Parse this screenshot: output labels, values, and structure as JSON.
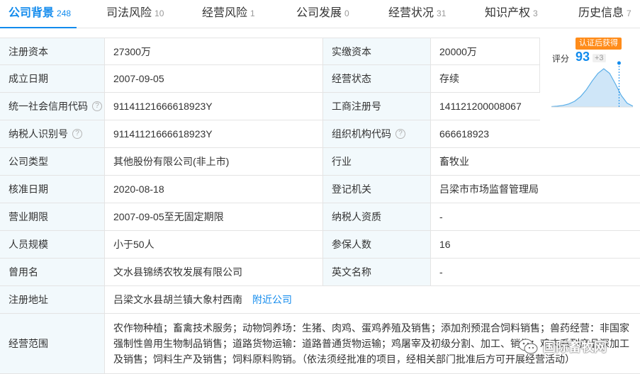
{
  "tabs": [
    {
      "label": "公司背景",
      "count": "248",
      "active": true
    },
    {
      "label": "司法风险",
      "count": "10"
    },
    {
      "label": "经营风险",
      "count": "1"
    },
    {
      "label": "公司发展",
      "count": "0"
    },
    {
      "label": "经营状况",
      "count": "31"
    },
    {
      "label": "知识产权",
      "count": "3"
    },
    {
      "label": "历史信息",
      "count": "7"
    }
  ],
  "info": {
    "reg_capital_label": "注册资本",
    "reg_capital": "27300万",
    "paid_capital_label": "实缴资本",
    "paid_capital": "20000万",
    "est_date_label": "成立日期",
    "est_date": "2007-09-05",
    "status_label": "经营状态",
    "status": "存续",
    "credit_code_label": "统一社会信用代码",
    "credit_code": "91141121666618923Y",
    "reg_no_label": "工商注册号",
    "reg_no": "141121200008067",
    "taxpayer_id_label": "纳税人识别号",
    "taxpayer_id": "91141121666618923Y",
    "org_code_label": "组织机构代码",
    "org_code": "666618923",
    "company_type_label": "公司类型",
    "company_type": "其他股份有限公司(非上市)",
    "industry_label": "行业",
    "industry": "畜牧业",
    "approval_date_label": "核准日期",
    "approval_date": "2020-08-18",
    "reg_authority_label": "登记机关",
    "reg_authority": "吕梁市市场监督管理局",
    "term_label": "营业期限",
    "term": "2007-09-05至无固定期限",
    "taxpayer_qual_label": "纳税人资质",
    "taxpayer_qual": "-",
    "staff_size_label": "人员规模",
    "staff_size": "小于50人",
    "insured_label": "参保人数",
    "insured": "16",
    "former_name_label": "曾用名",
    "former_name": "文水县锦绣农牧发展有限公司",
    "english_name_label": "英文名称",
    "english_name": "-",
    "address_label": "注册地址",
    "address": "吕梁文水县胡兰镇大象村西南",
    "nearby_link": "附近公司",
    "scope_label": "经营范围",
    "scope": "农作物种植；畜禽技术服务；动物饲养场：生猪、肉鸡、蛋鸡养殖及销售；添加剂预混合饲料销售；兽药经营：非国家强制性兽用生物制品销售；道路货物运输：道路普通货物运输；鸡屠宰及初级分割、加工、销售；鸡肉系列产品深加工及销售；饲料生产及销售；饲料原料购销。（依法须经批准的项目，经相关部门批准后方可开展经营活动）"
  },
  "help_icon": "?",
  "score": {
    "badge": "认证后获得",
    "label": "评分",
    "value": "93",
    "delta": "+3",
    "distribution": [
      0.01,
      0.02,
      0.04,
      0.08,
      0.15,
      0.27,
      0.45,
      0.68,
      0.88,
      1.0,
      0.88,
      0.6,
      0.3,
      0.1,
      0.02
    ],
    "curve_color": "#5aaee8",
    "marker_position": 0.83
  },
  "watermark": {
    "text": "国际畜牧网",
    "icon": "wechat-icon"
  },
  "colors": {
    "accent": "#128bed",
    "label_bg": "#f2f9fc",
    "border": "#e4e4e4",
    "badge": "#ff8c1a"
  }
}
